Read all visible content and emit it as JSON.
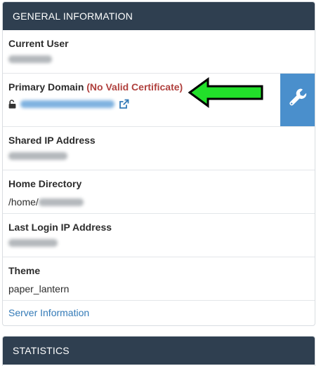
{
  "general": {
    "header": "GENERAL INFORMATION",
    "current_user": {
      "label": "Current User"
    },
    "primary_domain": {
      "label": "Primary Domain",
      "warning": "(No Valid Certificate)"
    },
    "shared_ip": {
      "label": "Shared IP Address"
    },
    "home_directory": {
      "label": "Home Directory",
      "prefix": "/home/"
    },
    "last_login": {
      "label": "Last Login IP Address"
    },
    "theme": {
      "label": "Theme",
      "value": "paper_lantern"
    },
    "server_info_link": "Server Information"
  },
  "statistics": {
    "header": "STATISTICS"
  },
  "icons": {
    "lock": "unlocked-lock-icon",
    "external": "external-link-icon",
    "wrench": "wrench-icon",
    "arrow": "green-arrow-icon"
  },
  "colors": {
    "header_bg": "#2f3f50",
    "warning": "#b0413e",
    "link": "#337ab7",
    "wrench_bg": "#4a8fcc",
    "arrow": "#22e02a"
  }
}
